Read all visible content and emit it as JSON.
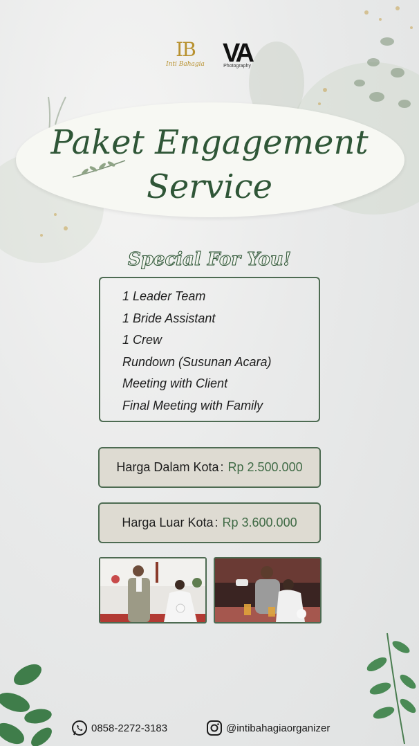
{
  "logos": {
    "left_monogram": "IB",
    "left_name": "Inti Bahagia",
    "right_monogram": "VA",
    "right_name": "Photography"
  },
  "title": {
    "line1": "Paket Engagement",
    "line2": "Service"
  },
  "special_heading": "Special For You!",
  "features": [
    "1 Leader Team",
    "1 Bride Assistant",
    "1 Crew",
    "Rundown (Susunan Acara)",
    "Meeting with Client",
    "Final Meeting with Family"
  ],
  "prices": [
    {
      "label": "Harga Dalam Kota",
      "sep": ":",
      "value": "Rp 2.500.000"
    },
    {
      "label": "Harga Luar Kota",
      "sep": ":",
      "value": "Rp 3.600.000"
    }
  ],
  "contact": {
    "phone": "0858-2272-3183",
    "instagram": "@intibahagiaorganizer",
    "phone_icon": "whatsapp-icon",
    "instagram_icon": "instagram-icon"
  },
  "colors": {
    "accent_green": "#2f5637",
    "price_green": "#3f6a45",
    "box_border": "#4d6b52",
    "price_bg": "#dedbd2",
    "gold": "#b8912f"
  }
}
